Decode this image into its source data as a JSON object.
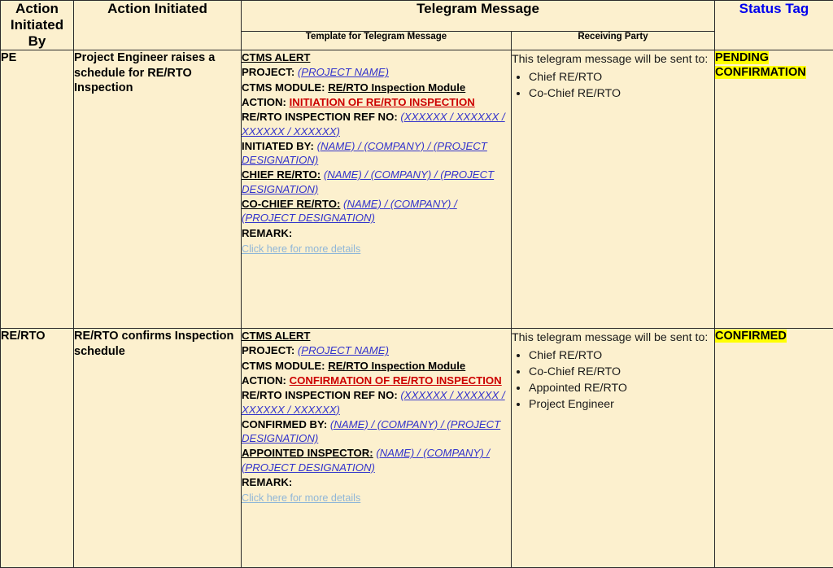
{
  "table": {
    "headers": {
      "action_initiated_by": "Action\nInitiated\nBy",
      "action_initiated_by_l1": "Action",
      "action_initiated_by_l2": "Initiated",
      "action_initiated_by_l3": "By",
      "action_initiated": "Action Initiated",
      "telegram_message": "Telegram Message",
      "template_for_telegram_message": "Template for Telegram Message",
      "receiving_party": "Receiving Party",
      "status_tag": "Status Tag"
    },
    "rows": [
      {
        "initiated_by": "PE",
        "action_initiated": "Project Engineer raises a schedule for RE/RTO Inspection",
        "template": {
          "title": "CTMS ALERT",
          "project_label": "PROJECT:",
          "project_value": "(PROJECT NAME)",
          "module_label": "CTMS MODULE:",
          "module_value": "RE/RTO Inspection Module",
          "action_label": "ACTION:",
          "action_value": "INITIATION OF RE/RTO INSPECTION",
          "ref_label": "RE/RTO INSPECTION REF NO:",
          "ref_value": "(XXXXXX / XXXXXX / XXXXXX / XXXXXX)",
          "fields": [
            {
              "label": "INITIATED BY:",
              "value": "(NAME) / (COMPANY) / (PROJECT DESIGNATION)"
            },
            {
              "label": "CHIEF RE/RTO:",
              "value": "(NAME) / (COMPANY) / (PROJECT DESIGNATION)"
            },
            {
              "label": "CO-CHIEF RE/RTO:",
              "value": "(NAME) / (COMPANY) / (PROJECT DESIGNATION)"
            }
          ],
          "remark_label": "REMARK:",
          "link": "Click here for more details"
        },
        "receiving": {
          "intro": "This telegram message will be sent to:",
          "parties": [
            "Chief RE/RTO",
            "Co-Chief RE/RTO"
          ]
        },
        "status": "PENDING CONFIRMATION"
      },
      {
        "initiated_by": "RE/RTO",
        "action_initiated": "RE/RTO confirms Inspection schedule",
        "template": {
          "title": "CTMS ALERT",
          "project_label": "PROJECT:",
          "project_value": "(PROJECT NAME)",
          "module_label": "CTMS MODULE:",
          "module_value": "RE/RTO Inspection Module",
          "action_label": "ACTION:",
          "action_value": "CONFIRMATION OF RE/RTO INSPECTION",
          "ref_label": "RE/RTO INSPECTION REF NO:",
          "ref_value": "(XXXXXX / XXXXXX / XXXXXX / XXXXXX)",
          "fields": [
            {
              "label": "CONFIRMED BY:",
              "value": "(NAME) / (COMPANY) / (PROJECT DESIGNATION)"
            },
            {
              "label": "APPOINTED INSPECTOR:",
              "value": "(NAME) / (COMPANY) / (PROJECT DESIGNATION)"
            }
          ],
          "remark_label": "REMARK:",
          "link": "Click here for more details"
        },
        "receiving": {
          "intro": "This telegram message will be sent to:",
          "parties": [
            "Chief RE/RTO",
            "Co-Chief RE/RTO",
            "Appointed RE/RTO",
            "Project Engineer"
          ]
        },
        "status": "CONFIRMED"
      }
    ]
  },
  "colors": {
    "header_bg": "#BDD0E9",
    "cell_bg": "#FCF0CE",
    "action_red": "#CC0000",
    "placeholder_blue": "#3333CC",
    "status_tag_blue": "#0000EE",
    "highlight_yellow": "#FFFF00",
    "link_blue": "#8FB6D8",
    "border": "#2B2B2B"
  }
}
